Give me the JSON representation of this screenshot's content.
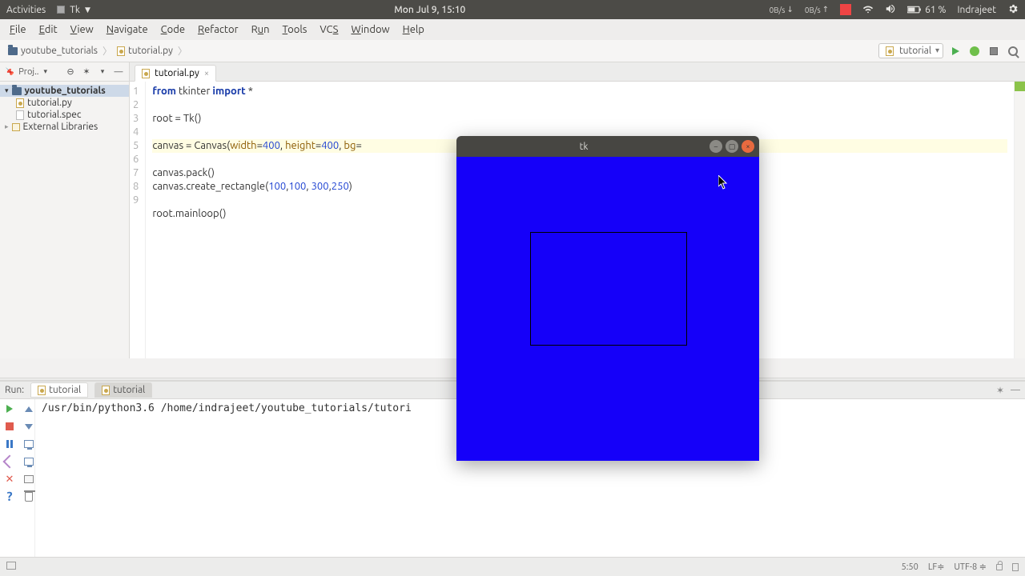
{
  "os_panel": {
    "activities": "Activities",
    "app_name": "Tk",
    "datetime": "Mon Jul  9, 15:10",
    "net_down": "0B/s",
    "net_up": "0B/s",
    "battery_pct": "61 %",
    "user": "Indrajeet"
  },
  "ide_menu": {
    "file": "File",
    "edit": "Edit",
    "view": "View",
    "navigate": "Navigate",
    "code": "Code",
    "refactor": "Refactor",
    "run": "Run",
    "tools": "Tools",
    "vcs": "VCS",
    "window": "Window",
    "help": "Help"
  },
  "breadcrumb": {
    "project": "youtube_tutorials",
    "file": "tutorial.py"
  },
  "run_config": {
    "selected": "tutorial"
  },
  "project_tree": {
    "header": "Proj..",
    "root": "youtube_tutorials",
    "items": [
      {
        "label": "tutorial.py",
        "kind": "py"
      },
      {
        "label": "tutorial.spec",
        "kind": "spec"
      }
    ],
    "external": "External Libraries"
  },
  "editor_tab": {
    "label": "tutorial.py"
  },
  "code_lines": {
    "l1": {
      "a": "from",
      "b": " tkinter ",
      "c": "import",
      "d": " *"
    },
    "l3": "root = Tk()",
    "l5": {
      "pre": "canvas = Canvas",
      "args": "(width=400, height=400, bg=",
      "w_kw": "width",
      "w_eq": "=",
      "w_v": "400",
      "h_kw": "height",
      "h_v": "400",
      "bg_kw": "bg"
    },
    "l6": "canvas.pack()",
    "l7": {
      "pre": "canvas.create_rectangle(",
      "n1": "100",
      "c1": ",",
      "n2": "100",
      "c2": ", ",
      "n3": "300",
      "c3": ",",
      "n4": "250",
      "post": ")"
    },
    "l9": "root.mainloop()"
  },
  "line_numbers": [
    "1",
    "2",
    "3",
    "4",
    "5",
    "6",
    "7",
    "8",
    "9"
  ],
  "run_panel": {
    "label": "Run:",
    "tab_inactive": "tutorial",
    "tab_active": "tutorial",
    "console_line": "/usr/bin/python3.6 /home/indrajeet/youtube_tutorials/tutori"
  },
  "status_bar": {
    "pos": "5:50",
    "line_sep": "LF",
    "encoding": "UTF-8"
  },
  "tk_window": {
    "title": "tk"
  }
}
